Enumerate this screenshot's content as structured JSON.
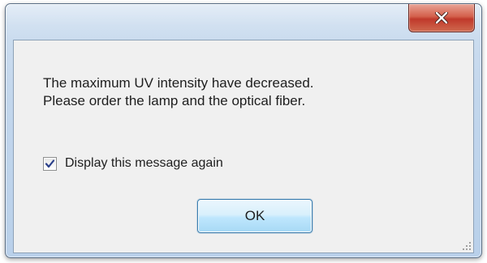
{
  "dialog": {
    "title": "",
    "close_icon": "close-x-icon",
    "message_lines": [
      "The maximum UV intensity have decreased.",
      "Please order the lamp and the optical fiber."
    ],
    "checkbox": {
      "label": "Display this message again",
      "checked": true
    },
    "ok_label": "OK",
    "grip_icon": "resize-grip-icon"
  },
  "colors": {
    "frame": "#c2d6ec",
    "close_button": "#c0392b",
    "client_background": "#f0f0f0",
    "ok_button_border": "#3c7fb1",
    "text": "#1e1e1e"
  }
}
